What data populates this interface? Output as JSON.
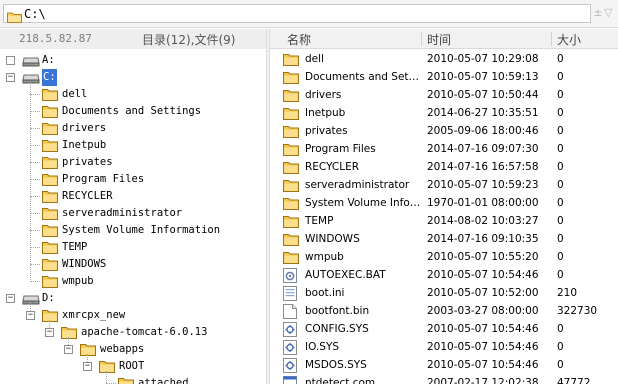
{
  "path": "C:\\",
  "top_arrows": [
    "±",
    "▽"
  ],
  "server_ip": "218.5.82.87",
  "counts_label": "目录(12),文件(9)",
  "columns": {
    "name": "名称",
    "time": "时间",
    "size": "大小"
  },
  "tree": [
    {
      "label": "A:",
      "icon": "drive-icon",
      "expander": ""
    },
    {
      "label": "C:",
      "icon": "drive-icon",
      "expander": "−",
      "selected": true
    },
    {
      "label": "dell",
      "icon": "folder-icon"
    },
    {
      "label": "Documents and Settings",
      "icon": "folder-icon"
    },
    {
      "label": "drivers",
      "icon": "folder-icon"
    },
    {
      "label": "Inetpub",
      "icon": "folder-icon"
    },
    {
      "label": "privates",
      "icon": "folder-icon"
    },
    {
      "label": "Program Files",
      "icon": "folder-icon"
    },
    {
      "label": "RECYCLER",
      "icon": "folder-icon"
    },
    {
      "label": "serveradministrator",
      "icon": "folder-icon"
    },
    {
      "label": "System Volume Information",
      "icon": "folder-icon"
    },
    {
      "label": "TEMP",
      "icon": "folder-icon"
    },
    {
      "label": "WINDOWS",
      "icon": "folder-icon"
    },
    {
      "label": "wmpub",
      "icon": "folder-icon"
    },
    {
      "label": "D:",
      "icon": "drive-icon",
      "expander": "−"
    },
    {
      "label": "xmrcpx_new",
      "icon": "folder-icon",
      "expander": "−"
    },
    {
      "label": "apache-tomcat-6.0.13",
      "icon": "folder-icon",
      "expander": "−"
    },
    {
      "label": "webapps",
      "icon": "folder-icon",
      "expander": "−"
    },
    {
      "label": "ROOT",
      "icon": "folder-icon",
      "expander": "−"
    },
    {
      "label": "attached",
      "icon": "folder-icon"
    }
  ],
  "files": [
    {
      "name": "dell",
      "time": "2010-05-07 10:29:08",
      "size": "0",
      "icon": "folder-icon"
    },
    {
      "name": "Documents and Settings",
      "time": "2010-05-07 10:59:13",
      "size": "0",
      "icon": "folder-icon"
    },
    {
      "name": "drivers",
      "time": "2010-05-07 10:50:44",
      "size": "0",
      "icon": "folder-icon"
    },
    {
      "name": "Inetpub",
      "time": "2014-06-27 10:35:51",
      "size": "0",
      "icon": "folder-icon"
    },
    {
      "name": "privates",
      "time": "2005-09-06 18:00:46",
      "size": "0",
      "icon": "folder-icon"
    },
    {
      "name": "Program Files",
      "time": "2014-07-16 09:07:30",
      "size": "0",
      "icon": "folder-icon"
    },
    {
      "name": "RECYCLER",
      "time": "2014-07-16 16:57:58",
      "size": "0",
      "icon": "folder-icon"
    },
    {
      "name": "serveradministrator",
      "time": "2010-05-07 10:59:23",
      "size": "0",
      "icon": "folder-icon"
    },
    {
      "name": "System Volume Inform...",
      "time": "1970-01-01 08:00:00",
      "size": "0",
      "icon": "folder-icon"
    },
    {
      "name": "TEMP",
      "time": "2014-08-02 10:03:27",
      "size": "0",
      "icon": "folder-icon"
    },
    {
      "name": "WINDOWS",
      "time": "2014-07-16 09:10:35",
      "size": "0",
      "icon": "folder-icon"
    },
    {
      "name": "wmpub",
      "time": "2010-05-07 10:55:20",
      "size": "0",
      "icon": "folder-icon"
    },
    {
      "name": "AUTOEXEC.BAT",
      "time": "2010-05-07 10:54:46",
      "size": "0",
      "icon": "bat-file-icon"
    },
    {
      "name": "boot.ini",
      "time": "2010-05-07 10:52:00",
      "size": "210",
      "icon": "ini-file-icon"
    },
    {
      "name": "bootfont.bin",
      "time": "2003-03-27 08:00:00",
      "size": "322730",
      "icon": "bin-file-icon"
    },
    {
      "name": "CONFIG.SYS",
      "time": "2010-05-07 10:54:46",
      "size": "0",
      "icon": "sys-file-icon"
    },
    {
      "name": "IO.SYS",
      "time": "2010-05-07 10:54:46",
      "size": "0",
      "icon": "sys-file-icon"
    },
    {
      "name": "MSDOS.SYS",
      "time": "2010-05-07 10:54:46",
      "size": "0",
      "icon": "sys-file-icon"
    },
    {
      "name": "ntdetect.com",
      "time": "2007-02-17 12:02:38",
      "size": "47772",
      "icon": "com-file-icon"
    }
  ]
}
